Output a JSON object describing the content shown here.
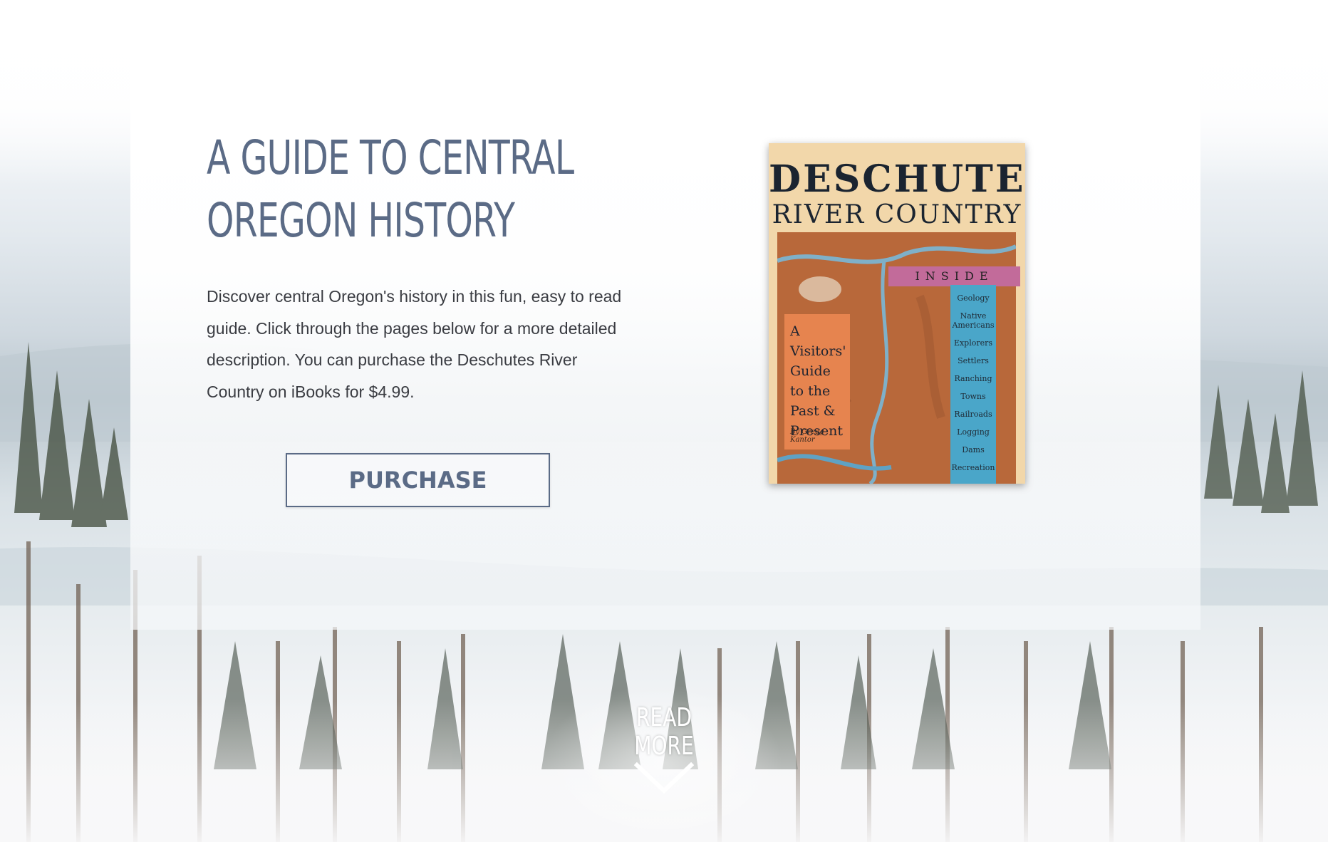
{
  "hero": {
    "title_line1": "A GUIDE TO CENTRAL",
    "title_line2": "OREGON HISTORY",
    "description": "Discover central Oregon's history in this fun, easy to read guide. Click through the pages below for a more detailed description. You can purchase the Deschutes River Country on iBooks for $4.99.",
    "purchase_label": "PURCHASE"
  },
  "book_cover": {
    "title_top": "DESCHUTES",
    "title_bottom": "RIVER COUNTRY",
    "inside_label": "INSIDE",
    "subtitle_lines": [
      "A Visitors'",
      "Guide",
      "to the",
      "Past &",
      "Present"
    ],
    "author": "By Gregg Kantor",
    "topics": [
      "Geology",
      "Native Americans",
      "Explorers",
      "Settlers",
      "Ranching",
      "Towns",
      "Railroads",
      "Logging",
      "Dams",
      "Recreation"
    ]
  },
  "read_more": {
    "line1": "READ",
    "line2": "MORE",
    "icon": "chevron-down-icon"
  },
  "colors": {
    "accent": "#5b6b86",
    "text": "#3a3c42"
  }
}
